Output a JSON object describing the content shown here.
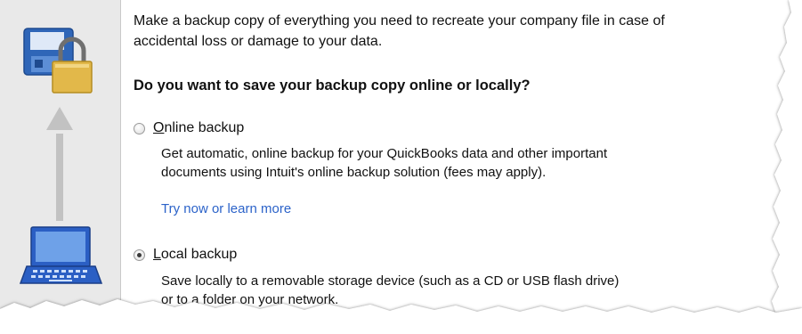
{
  "intro": {
    "line1": "Make a backup copy of everything you need to recreate your company file in case of",
    "line2": "accidental loss or damage to your data."
  },
  "question": "Do you want to save your backup copy online or locally?",
  "options": [
    {
      "first_letter": "O",
      "rest": "nline backup",
      "checked": false,
      "desc_line1": "Get automatic, online backup for your QuickBooks data and other important",
      "desc_line2": "documents using Intuit's online backup solution (fees may apply).",
      "link": "Try now or learn more"
    },
    {
      "first_letter": "L",
      "rest": "ocal backup",
      "checked": true,
      "desc_line1": "Save locally to a removable storage device (such as a CD or USB flash drive)",
      "desc_line2": "or to a folder on your network."
    }
  ],
  "icons": {
    "top": "floppy-and-lock-icon",
    "arrow": "up-arrow-icon",
    "bottom": "laptop-icon"
  },
  "colors": {
    "link": "#2c63c9",
    "sidebar": "#e9e9e9",
    "floppy": "#2f66b8",
    "lock": "#e2b84a",
    "laptop": "#2b5fc4"
  }
}
